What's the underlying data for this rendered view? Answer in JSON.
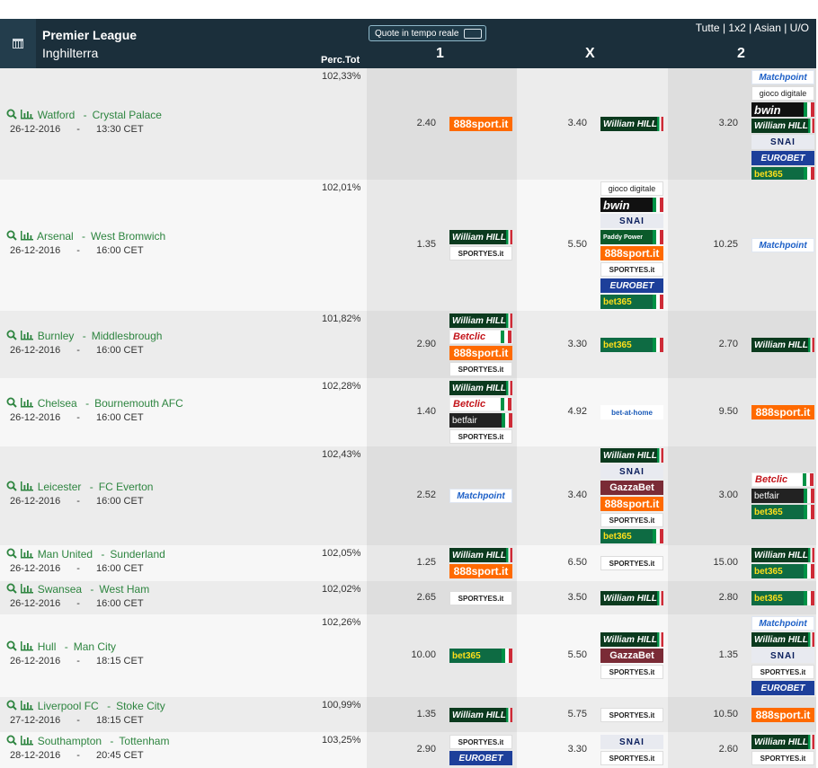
{
  "header": {
    "league": "Premier League",
    "country": "Inghilterra",
    "live_label": "Quote in tempo reale",
    "filters": "Tutte | 1x2 | Asian | U/O",
    "perc_tot": "Perc.Tot",
    "col1": "1",
    "colx": "X",
    "col2": "2"
  },
  "matches": [
    {
      "home": "Watford",
      "away": "Crystal Palace",
      "sep": "-",
      "date": "26-12-2016",
      "dash": "-",
      "time": "13:30 CET",
      "pct": "102,33%",
      "o1": "2.40",
      "ox": "3.40",
      "o2": "3.20"
    },
    {
      "home": "Arsenal",
      "away": "West Bromwich",
      "sep": "-",
      "date": "26-12-2016",
      "dash": "-",
      "time": "16:00 CET",
      "pct": "102,01%",
      "o1": "1.35",
      "ox": "5.50",
      "o2": "10.25"
    },
    {
      "home": "Burnley",
      "away": "Middlesbrough",
      "sep": "-",
      "date": "26-12-2016",
      "dash": "-",
      "time": "16:00 CET",
      "pct": "101,82%",
      "o1": "2.90",
      "ox": "3.30",
      "o2": "2.70"
    },
    {
      "home": "Chelsea",
      "away": "Bournemouth AFC",
      "sep": "-",
      "date": "26-12-2016",
      "dash": "-",
      "time": "16:00 CET",
      "pct": "102,28%",
      "o1": "1.40",
      "ox": "4.92",
      "o2": "9.50"
    },
    {
      "home": "Leicester",
      "away": "FC Everton",
      "sep": "-",
      "date": "26-12-2016",
      "dash": "-",
      "time": "16:00 CET",
      "pct": "102,43%",
      "o1": "2.52",
      "ox": "3.40",
      "o2": "3.00"
    },
    {
      "home": "Man United",
      "away": "Sunderland",
      "sep": "-",
      "date": "26-12-2016",
      "dash": "-",
      "time": "16:00 CET",
      "pct": "102,05%",
      "o1": "1.25",
      "ox": "6.50",
      "o2": "15.00"
    },
    {
      "home": "Swansea",
      "away": "West Ham",
      "sep": "-",
      "date": "26-12-2016",
      "dash": "-",
      "time": "16:00 CET",
      "pct": "102,02%",
      "o1": "2.65",
      "ox": "3.50",
      "o2": "2.80"
    },
    {
      "home": "Hull",
      "away": "Man City",
      "sep": "-",
      "date": "26-12-2016",
      "dash": "-",
      "time": "18:15 CET",
      "pct": "102,26%",
      "o1": "10.00",
      "ox": "5.50",
      "o2": "1.35"
    },
    {
      "home": "Liverpool FC",
      "away": "Stoke City",
      "sep": "-",
      "date": "27-12-2016",
      "dash": "-",
      "time": "18:15 CET",
      "pct": "100,99%",
      "o1": "1.35",
      "ox": "5.75",
      "o2": "10.50"
    },
    {
      "home": "Southampton",
      "away": "Tottenham",
      "sep": "-",
      "date": "28-12-2016",
      "dash": "-",
      "time": "20:45 CET",
      "pct": "103,25%",
      "o1": "2.90",
      "ox": "3.30",
      "o2": "2.60"
    }
  ],
  "bookmakers": {
    "wh": "William HILL",
    "b365": "bet365",
    "s888": "888sport.it",
    "snai": "SNAI",
    "euro": "EUROBET",
    "bwin": "bwin",
    "mp": "Matchpoint",
    "gd": "gioco digitale",
    "sp": "SPORTYES.it",
    "pp": "Paddy Power",
    "bc": "Betclic",
    "bf": "betfair",
    "gb": "GazzaBet",
    "bah": "bet-at-home"
  }
}
